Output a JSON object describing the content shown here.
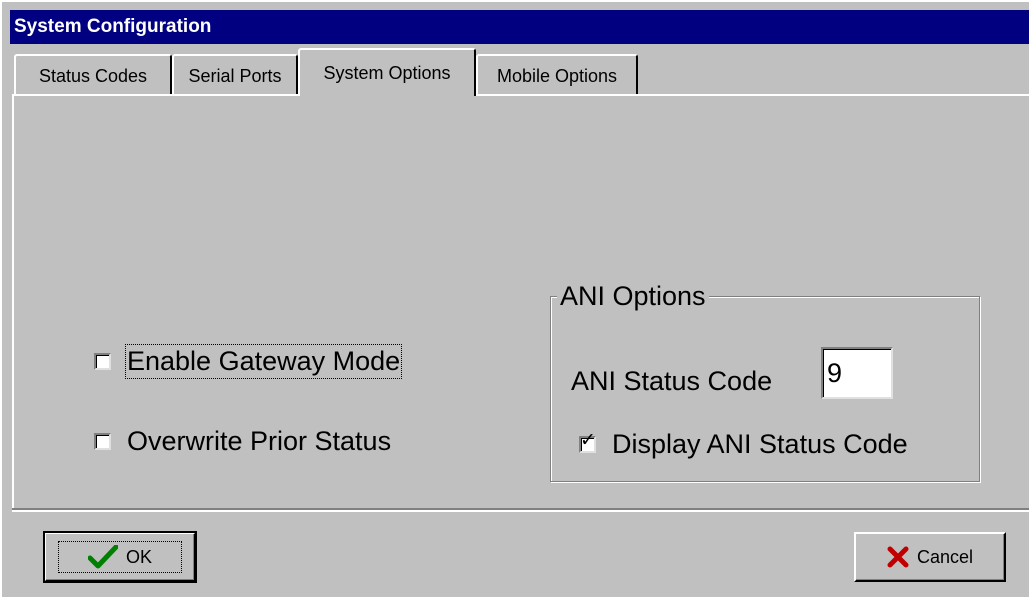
{
  "window": {
    "title": "System Configuration"
  },
  "tabs": [
    {
      "label": "Status Codes"
    },
    {
      "label": "Serial Ports"
    },
    {
      "label": "System Options",
      "selected": true
    },
    {
      "label": "Mobile Options"
    }
  ],
  "system_options": {
    "enable_gateway_mode": {
      "label": "Enable Gateway Mode",
      "checked": false
    },
    "overwrite_prior_status": {
      "label": "Overwrite Prior Status",
      "checked": false
    }
  },
  "ani_options": {
    "title": "ANI Options",
    "status_code_label": "ANI Status Code",
    "status_code_value": "9",
    "display_ani_status_code": {
      "label": "Display ANI Status Code",
      "checked": true
    }
  },
  "buttons": {
    "ok": {
      "label": "OK",
      "icon": "checkmark-icon",
      "icon_color": "#008000"
    },
    "cancel": {
      "label": "Cancel",
      "icon": "x-icon",
      "icon_color": "#c00000"
    }
  },
  "colors": {
    "titlebar": "#000080",
    "face": "#c0c0c0"
  }
}
